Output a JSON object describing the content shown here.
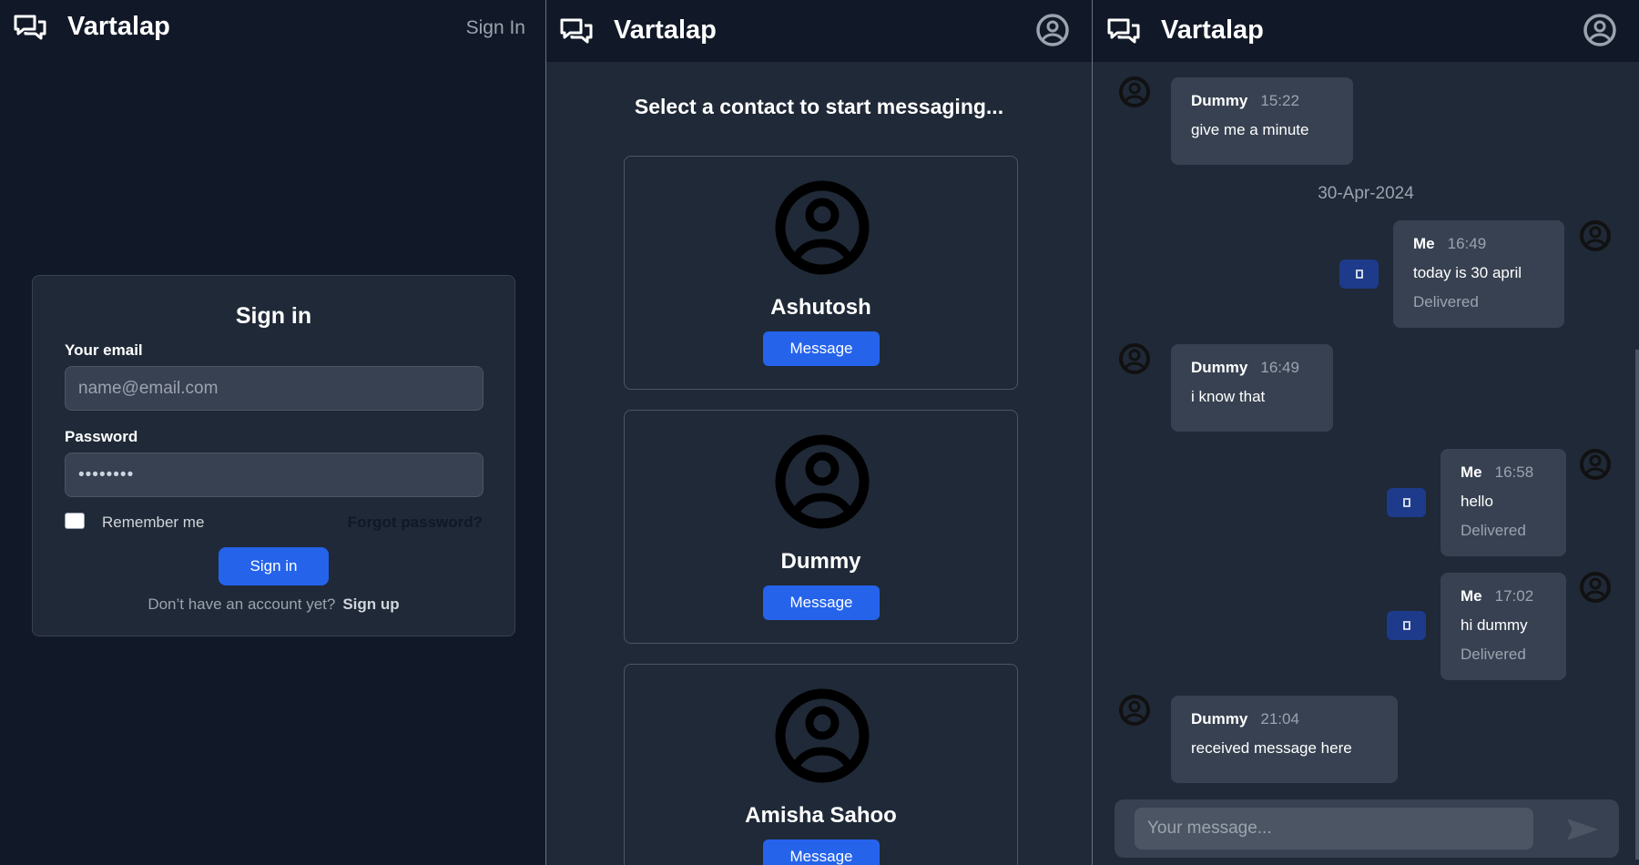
{
  "signin_panel": {
    "brand": "Vartalap",
    "nav_signin": "Sign In",
    "title": "Sign in",
    "email_label": "Your email",
    "email_placeholder": "name@email.com",
    "password_label": "Password",
    "password_value": "••••••••",
    "remember_label": "Remember me",
    "forgot_label": "Forgot password?",
    "submit_label": "Sign in",
    "no_account_text": "Don’t have an account yet?",
    "signup_label": "Sign up"
  },
  "contacts_panel": {
    "brand": "Vartalap",
    "title": "Select a contact to start messaging...",
    "contacts": [
      {
        "name": "Ashutosh",
        "button": "Message"
      },
      {
        "name": "Dummy",
        "button": "Message"
      },
      {
        "name": "Amisha Sahoo",
        "button": "Message"
      }
    ]
  },
  "chat_panel": {
    "brand": "Vartalap",
    "date_separator": "30-Apr-2024",
    "messages": [
      {
        "sender": "Dummy",
        "time": "15:22",
        "text": "give me a minute",
        "status": ""
      },
      {
        "sender": "Me",
        "time": "16:49",
        "text": "today is 30 april",
        "status": "Delivered"
      },
      {
        "sender": "Dummy",
        "time": "16:49",
        "text": "i know that",
        "status": ""
      },
      {
        "sender": "Me",
        "time": "16:58",
        "text": "hello",
        "status": "Delivered"
      },
      {
        "sender": "Me",
        "time": "17:02",
        "text": "hi dummy",
        "status": "Delivered"
      },
      {
        "sender": "Dummy",
        "time": "21:04",
        "text": "received message here",
        "status": ""
      }
    ],
    "input_placeholder": "Your message..."
  },
  "icons": {
    "brand": "chat-bubbles-icon",
    "profile": "user-circle-icon",
    "delete": "trash-icon",
    "send": "send-icon"
  },
  "colors": {
    "background": "#111827",
    "panel": "#1f2937",
    "card": "#374151",
    "accent": "#2563eb",
    "delete_button": "#1e3a8a"
  }
}
